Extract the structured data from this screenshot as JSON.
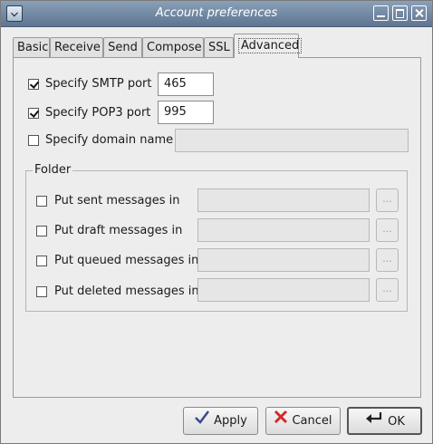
{
  "window": {
    "title": "Account preferences"
  },
  "tabs": [
    {
      "label": "Basic"
    },
    {
      "label": "Receive"
    },
    {
      "label": "Send"
    },
    {
      "label": "Compose"
    },
    {
      "label": "SSL"
    },
    {
      "label": "Advanced"
    }
  ],
  "advanced": {
    "smtp": {
      "label": "Specify SMTP port",
      "checked": true,
      "value": "465"
    },
    "pop3": {
      "label": "Specify POP3 port",
      "checked": true,
      "value": "995"
    },
    "domain": {
      "label": "Specify domain name",
      "checked": false,
      "value": ""
    },
    "folder": {
      "title": "Folder",
      "rows": [
        {
          "label": "Put sent messages in",
          "checked": false,
          "value": "",
          "browse": "..."
        },
        {
          "label": "Put draft messages in",
          "checked": false,
          "value": "",
          "browse": "..."
        },
        {
          "label": "Put queued messages in",
          "checked": false,
          "value": "",
          "browse": "..."
        },
        {
          "label": "Put deleted messages in",
          "checked": false,
          "value": "",
          "browse": "..."
        }
      ]
    }
  },
  "buttons": {
    "apply": "Apply",
    "cancel": "Cancel",
    "ok": "OK"
  },
  "icons": {
    "apply": "checkmark-icon",
    "cancel": "red-x-icon",
    "ok": "enter-arrow-icon"
  },
  "colors": {
    "titlebar": "#6f86a3",
    "cancel_icon": "#d22a2a",
    "apply_icon": "#3a4a8a"
  }
}
